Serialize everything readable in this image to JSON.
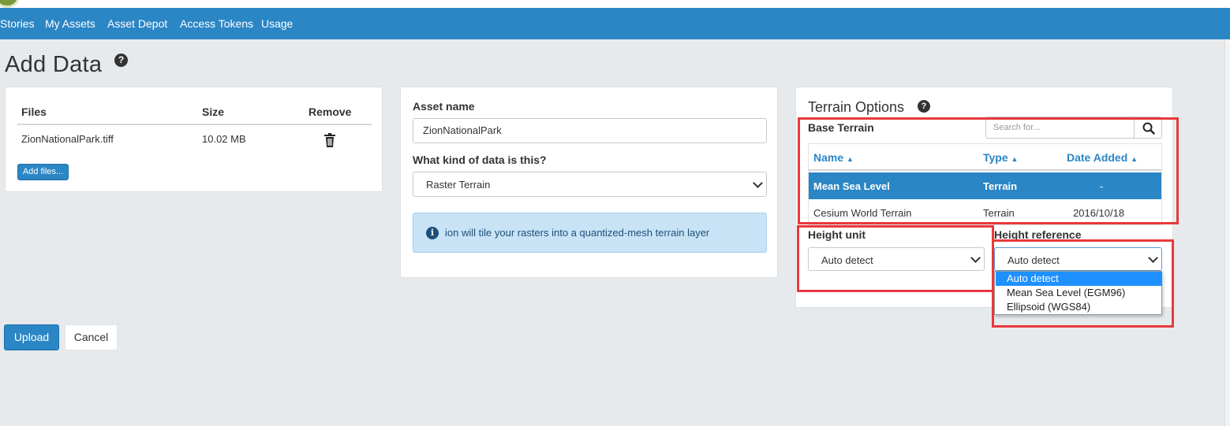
{
  "nav": {
    "items": [
      "Stories",
      "My Assets",
      "Asset Depot",
      "Access Tokens",
      "Usage"
    ]
  },
  "page": {
    "title": "Add Data"
  },
  "files": {
    "headers": {
      "files": "Files",
      "size": "Size",
      "remove": "Remove"
    },
    "rows": [
      {
        "name": "ZionNationalPark.tiff",
        "size": "10.02 MB"
      }
    ],
    "add_button": "Add files..."
  },
  "asset": {
    "name_label": "Asset name",
    "name_value": "ZionNationalPark",
    "kind_label": "What kind of data is this?",
    "kind_value": "Raster Terrain",
    "info_text": "ion will tile your rasters into a quantized-mesh terrain layer"
  },
  "terrain": {
    "title": "Terrain Options",
    "base_label": "Base Terrain",
    "search_placeholder": "Search for...",
    "columns": {
      "name": "Name",
      "type": "Type",
      "date": "Date Added"
    },
    "rows": [
      {
        "name": "Mean Sea Level",
        "type": "Terrain",
        "date": "-"
      },
      {
        "name": "Cesium World Terrain",
        "type": "Terrain",
        "date": "2016/10/18"
      }
    ],
    "height_unit_label": "Height unit",
    "height_unit_value": "Auto detect",
    "height_ref_label": "Height reference",
    "height_ref_value": "Auto detect",
    "height_ref_options": [
      "Auto detect",
      "Mean Sea Level (EGM96)",
      "Ellipsoid (WGS84)"
    ]
  },
  "actions": {
    "upload": "Upload",
    "cancel": "Cancel"
  },
  "colors": {
    "accent": "#2b86c5",
    "highlight": "#e8393d",
    "background": "#e6eaed"
  }
}
